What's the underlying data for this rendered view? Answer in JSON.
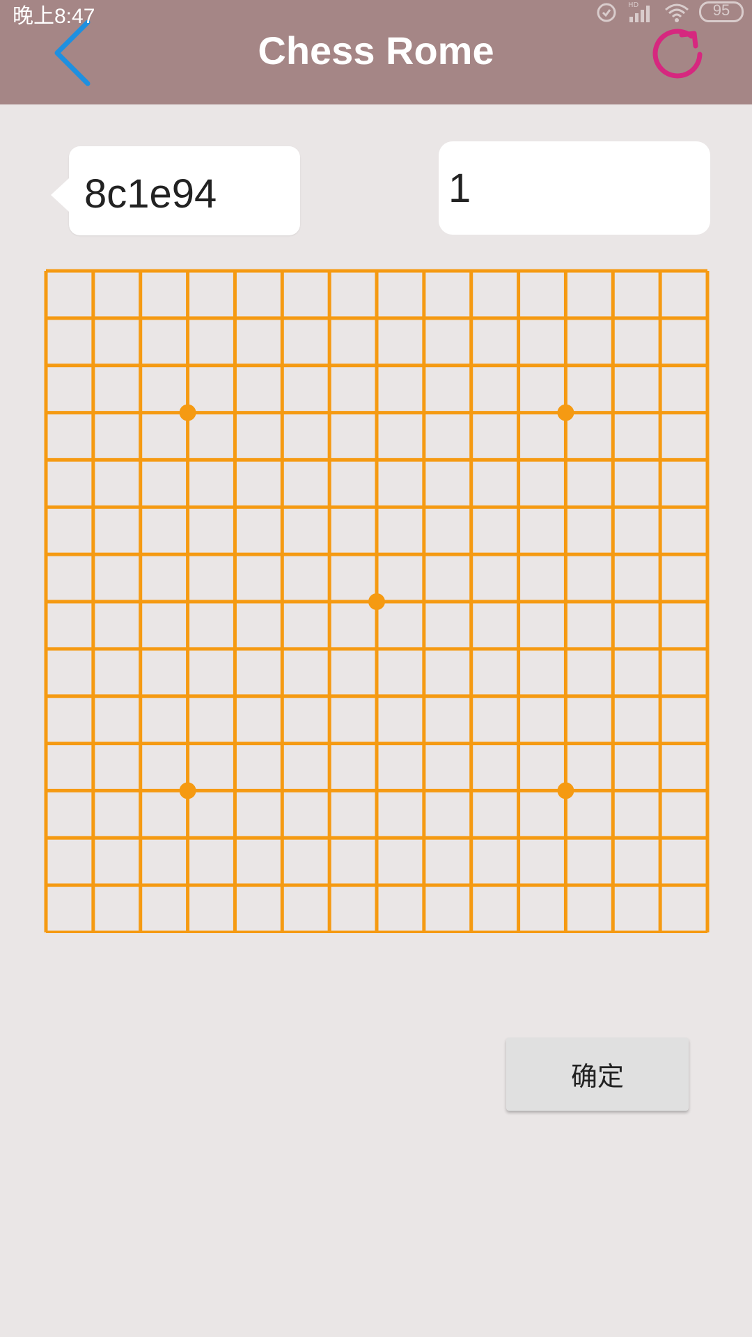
{
  "status_bar": {
    "time": "晚上8:47",
    "battery": "95",
    "icons": [
      "alarm-icon",
      "signal-hd-icon",
      "wifi-icon",
      "battery-icon"
    ]
  },
  "header": {
    "title": "Chess Rome",
    "back_icon": "chevron-left-icon",
    "refresh_icon": "refresh-icon",
    "colors": {
      "bar": "#a58686",
      "back": "#1e90e0",
      "refresh": "#d6287f"
    }
  },
  "room": {
    "id_label": "8c1e94",
    "input_value": "1"
  },
  "board": {
    "lines": 15,
    "star_points": [
      [
        3,
        3
      ],
      [
        11,
        3
      ],
      [
        7,
        7
      ],
      [
        3,
        11
      ],
      [
        11,
        11
      ]
    ],
    "color": "#f59a12"
  },
  "actions": {
    "confirm_label": "确定"
  }
}
